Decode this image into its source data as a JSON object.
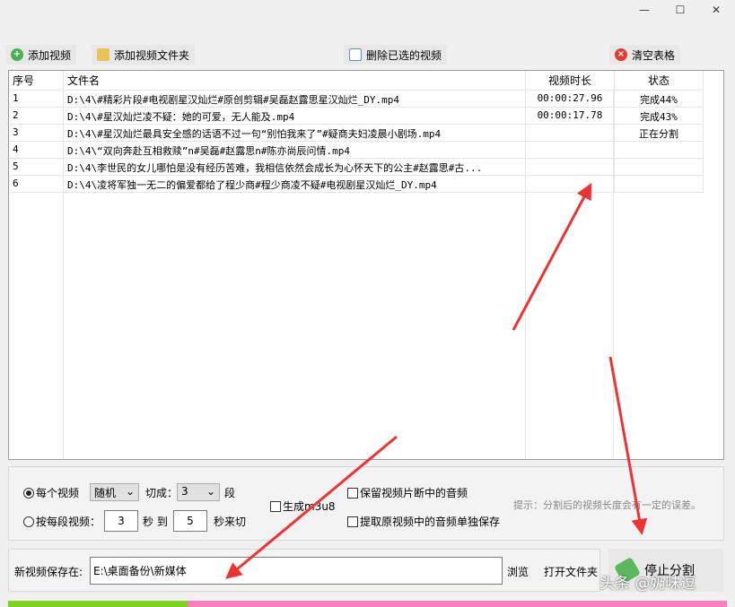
{
  "window": {
    "minimize": "—",
    "maximize": "☐",
    "close": "✕"
  },
  "toolbar": {
    "add_video": "添加视频",
    "add_folder": "添加视频文件夹",
    "delete_selected": "删除已选的视频",
    "clear_table": "清空表格"
  },
  "table": {
    "headers": [
      "序号",
      "文件名",
      "视频时长",
      "状态"
    ],
    "rows": [
      {
        "n": "1",
        "file": "D:\\4\\#精彩片段#电视剧星汉灿烂#原创剪辑#吴磊赵露思星汉灿烂_DY.mp4",
        "dur": "00:00:27.96",
        "status": "完成44%"
      },
      {
        "n": "2",
        "file": "D:\\4\\#星汉灿烂凌不疑：她的可爱，无人能及.mp4",
        "dur": "00:00:17.78",
        "status": "完成43%"
      },
      {
        "n": "3",
        "file": "D:\\4\\#星汉灿烂最具安全感的话语不过一句“别怕我来了”#疑商夫妇凌晨小剧场.mp4",
        "dur": "",
        "status": "正在分割"
      },
      {
        "n": "4",
        "file": "D:\\4\\“双向奔赴互相救赎”n#吴磊#赵露思n#陈亦尚辰问情.mp4",
        "dur": "",
        "status": ""
      },
      {
        "n": "5",
        "file": "D:\\4\\李世民的女儿哪怕是没有经历苦难，我相信依然会成长为心怀天下的公主#赵露思#古...",
        "dur": "",
        "status": ""
      },
      {
        "n": "6",
        "file": "D:\\4\\凌将军独一无二的偏爱都给了程少商#程少商凌不疑#电视剧星汉灿烂_DY.mp4",
        "dur": "",
        "status": ""
      }
    ]
  },
  "options": {
    "each_video": "每个视频",
    "mode_value": "随机",
    "cut_into": "切成：",
    "segments_value": "3",
    "segment_unit": "段",
    "per_segment": "按每段视频：",
    "from_sec": "3",
    "sec_to": "秒 到",
    "to_sec": "5",
    "sec_cut": "秒来切",
    "gen_m3u8": "生成m3u8",
    "keep_audio": "保留视频片断中的音频",
    "extract_audio": "提取原视频中的音频单独保存",
    "hint": "提示：分割后的视频长度会有一定的误差。"
  },
  "save": {
    "label": "新视频保存在:",
    "path": "E:\\桌面备份\\新媒体",
    "browse": "浏览",
    "open_folder": "打开文件夹"
  },
  "stop_button": "停止分割",
  "watermark": "头条 @奶味逗",
  "progress": {
    "fraction": 0.25,
    "done_color": "#7ed321",
    "rest_color": "#f77fbe"
  }
}
